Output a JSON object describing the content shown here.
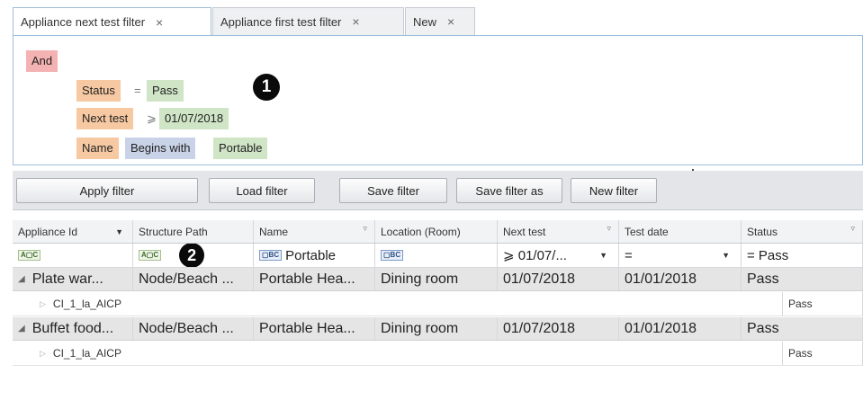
{
  "tabs": [
    {
      "label": "Appliance next test filter",
      "close": "×"
    },
    {
      "label": "Appliance first test filter",
      "close": "×"
    },
    {
      "label": "New",
      "close": "×"
    }
  ],
  "editor": {
    "and_label": "And",
    "conditions": [
      {
        "field": "Status",
        "operator": "=",
        "value": "Pass"
      },
      {
        "field": "Next test",
        "operator": "⩾",
        "value": "01/07/2018"
      },
      {
        "field": "Name",
        "operator": "Begins with",
        "value": "Portable"
      }
    ],
    "badge_1": "1",
    "badge_2": "2"
  },
  "buttons": {
    "apply": "Apply filter",
    "load": "Load filter",
    "save": "Save filter",
    "save_as": "Save filter as",
    "new": "New filter"
  },
  "grid": {
    "columns": [
      "Appliance Id",
      "Structure Path",
      "Name",
      "Location (Room)",
      "Next test",
      "Test date",
      "Status"
    ],
    "filter_row": {
      "name": "Portable",
      "next_test": "⩾ 01/07/...",
      "test_date": "=",
      "status": "= Pass",
      "icon_mixed": "A▢C",
      "icon_text": "▢BC"
    },
    "rows": [
      {
        "appliance_id": "Plate war...",
        "structure_path": "Node/Beach ...",
        "name": "Portable Hea...",
        "location": "Dining room",
        "next_test": "01/07/2018",
        "test_date": "01/01/2018",
        "status": "Pass",
        "child": {
          "label": "CI_1_la_AICP",
          "status": "Pass"
        }
      },
      {
        "appliance_id": "Buffet food...",
        "structure_path": "Node/Beach ...",
        "name": "Portable Hea...",
        "location": "Dining room",
        "next_test": "01/07/2018",
        "test_date": "01/01/2018",
        "status": "Pass",
        "child": {
          "label": "CI_1_la_AICP",
          "status": "Pass"
        }
      }
    ]
  }
}
